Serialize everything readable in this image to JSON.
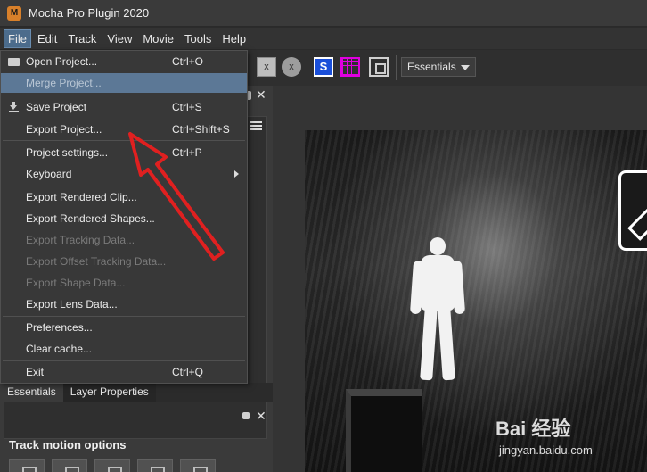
{
  "window": {
    "title": "Mocha Pro Plugin 2020"
  },
  "menubar": {
    "items": [
      "File",
      "Edit",
      "Track",
      "View",
      "Movie",
      "Tools",
      "Help"
    ]
  },
  "toolbar": {
    "btn_x_square": "x",
    "btn_x_circle": "x",
    "btn_s": "S",
    "layout_value": "Essentials"
  },
  "file_menu": {
    "items": [
      {
        "label": "Open Project...",
        "shortcut": "Ctrl+O"
      },
      {
        "label": "Merge Project...",
        "shortcut": ""
      },
      {
        "label": "Save Project",
        "shortcut": "Ctrl+S"
      },
      {
        "label": "Export Project...",
        "shortcut": "Ctrl+Shift+S"
      },
      {
        "label": "Project settings...",
        "shortcut": "Ctrl+P"
      },
      {
        "label": "Keyboard",
        "shortcut": ""
      },
      {
        "label": "Export Rendered Clip...",
        "shortcut": ""
      },
      {
        "label": "Export Rendered Shapes...",
        "shortcut": ""
      },
      {
        "label": "Export Tracking Data...",
        "shortcut": ""
      },
      {
        "label": "Export Offset Tracking Data...",
        "shortcut": ""
      },
      {
        "label": "Export Shape Data...",
        "shortcut": ""
      },
      {
        "label": "Export Lens Data...",
        "shortcut": ""
      },
      {
        "label": "Preferences...",
        "shortcut": ""
      },
      {
        "label": "Clear cache...",
        "shortcut": ""
      },
      {
        "label": "Exit",
        "shortcut": "Ctrl+Q"
      }
    ]
  },
  "left_panel": {
    "tabs": [
      "Essentials",
      "Layer Properties"
    ],
    "section_title": "Track motion options"
  },
  "watermark": {
    "brand": "Bai 经验",
    "url": "jingyan.baidu.com"
  },
  "colors": {
    "menu_highlight": "#5c7896",
    "annotation_red": "#e02020"
  }
}
